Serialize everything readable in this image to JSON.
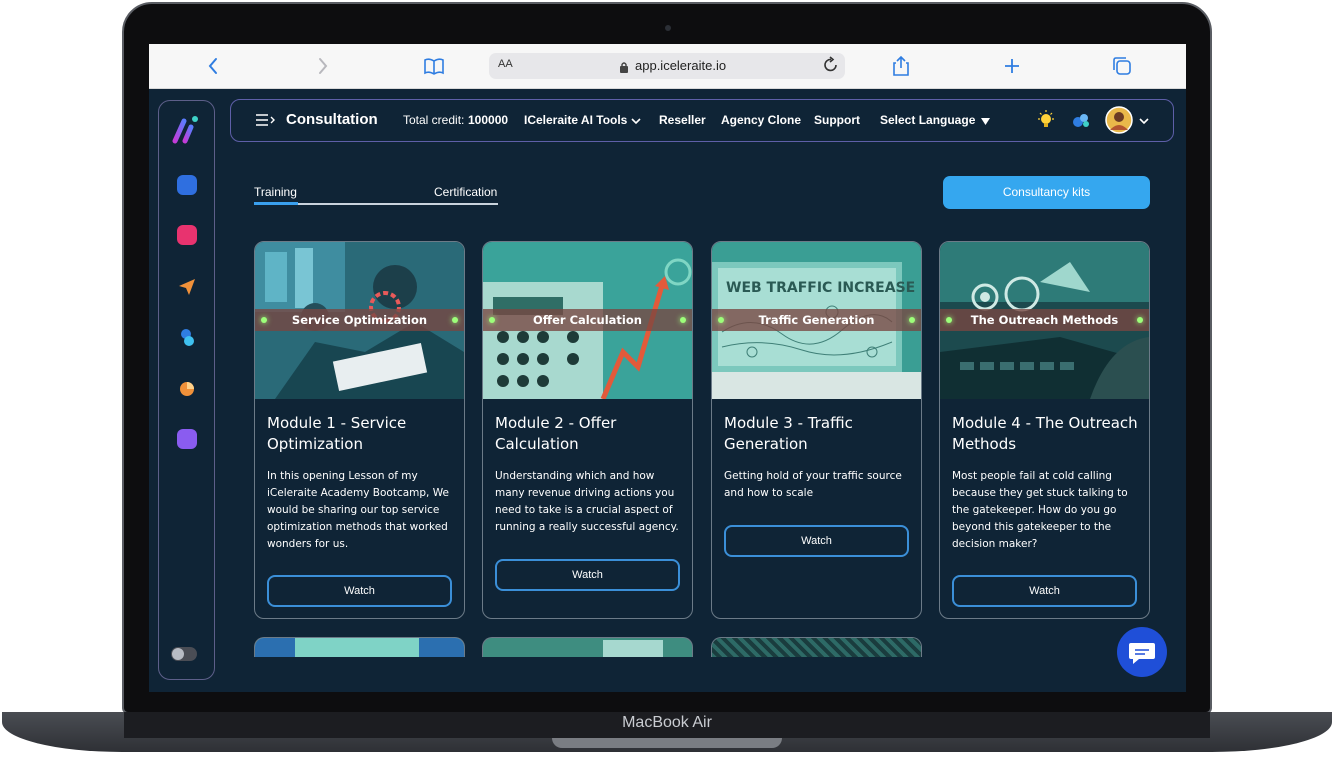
{
  "device": {
    "brand": "MacBook Air"
  },
  "browser": {
    "url": "app.iceleraite.io",
    "aa_label": "AA",
    "icons": [
      "back-icon",
      "forward-icon",
      "bookmarks-icon",
      "lock-icon",
      "reload-icon",
      "share-icon",
      "new-tab-icon",
      "tabs-icon"
    ]
  },
  "topbar": {
    "title": "Consultation",
    "credit_label": "Total credit:",
    "credit_value": "100000",
    "menu": [
      "ICeleraite AI Tools",
      "Reseller",
      "Agency Clone",
      "Support",
      "Select Language"
    ],
    "icons": [
      "menu-icon",
      "chevron-down-icon",
      "bulb-icon",
      "apps-icon",
      "avatar",
      "chevron-down-icon"
    ]
  },
  "tabs": {
    "training": "Training",
    "certification": "Certification",
    "active": "Training"
  },
  "kits_button": "Consultancy kits",
  "cards": [
    {
      "banner": "Service Optimization",
      "title": "Module 1 - Service Optimization",
      "description": "In this opening Lesson of my iCeleraite Academy Bootcamp, We would be sharing our top service optimization methods that worked wonders for us.",
      "button": "Watch"
    },
    {
      "banner": "Offer Calculation",
      "title": "Module 2 - Offer Calculation",
      "description": "Understanding which and how many revenue driving actions you need to take is a crucial aspect of running a really successful agency.",
      "button": "Watch"
    },
    {
      "banner": "Traffic Generation",
      "title": "Module 3 - Traffic Generation",
      "description": "Getting hold of your traffic source and how to scale",
      "button": "Watch",
      "image_text": "WEB TRAFFIC INCREASE"
    },
    {
      "banner": "The Outreach Methods",
      "title": "Module 4 - The Outreach Methods",
      "description": "Most people fail at cold calling because they get stuck talking to the gatekeeper. How do you go beyond this gatekeeper to the decision maker?",
      "button": "Watch"
    }
  ],
  "colors": {
    "background": "#0f2436",
    "accent": "#35a7ef",
    "card_border": "#6c7b88",
    "topbar_border": "#5e5fa8",
    "chat_fab": "#1f4fd8"
  }
}
